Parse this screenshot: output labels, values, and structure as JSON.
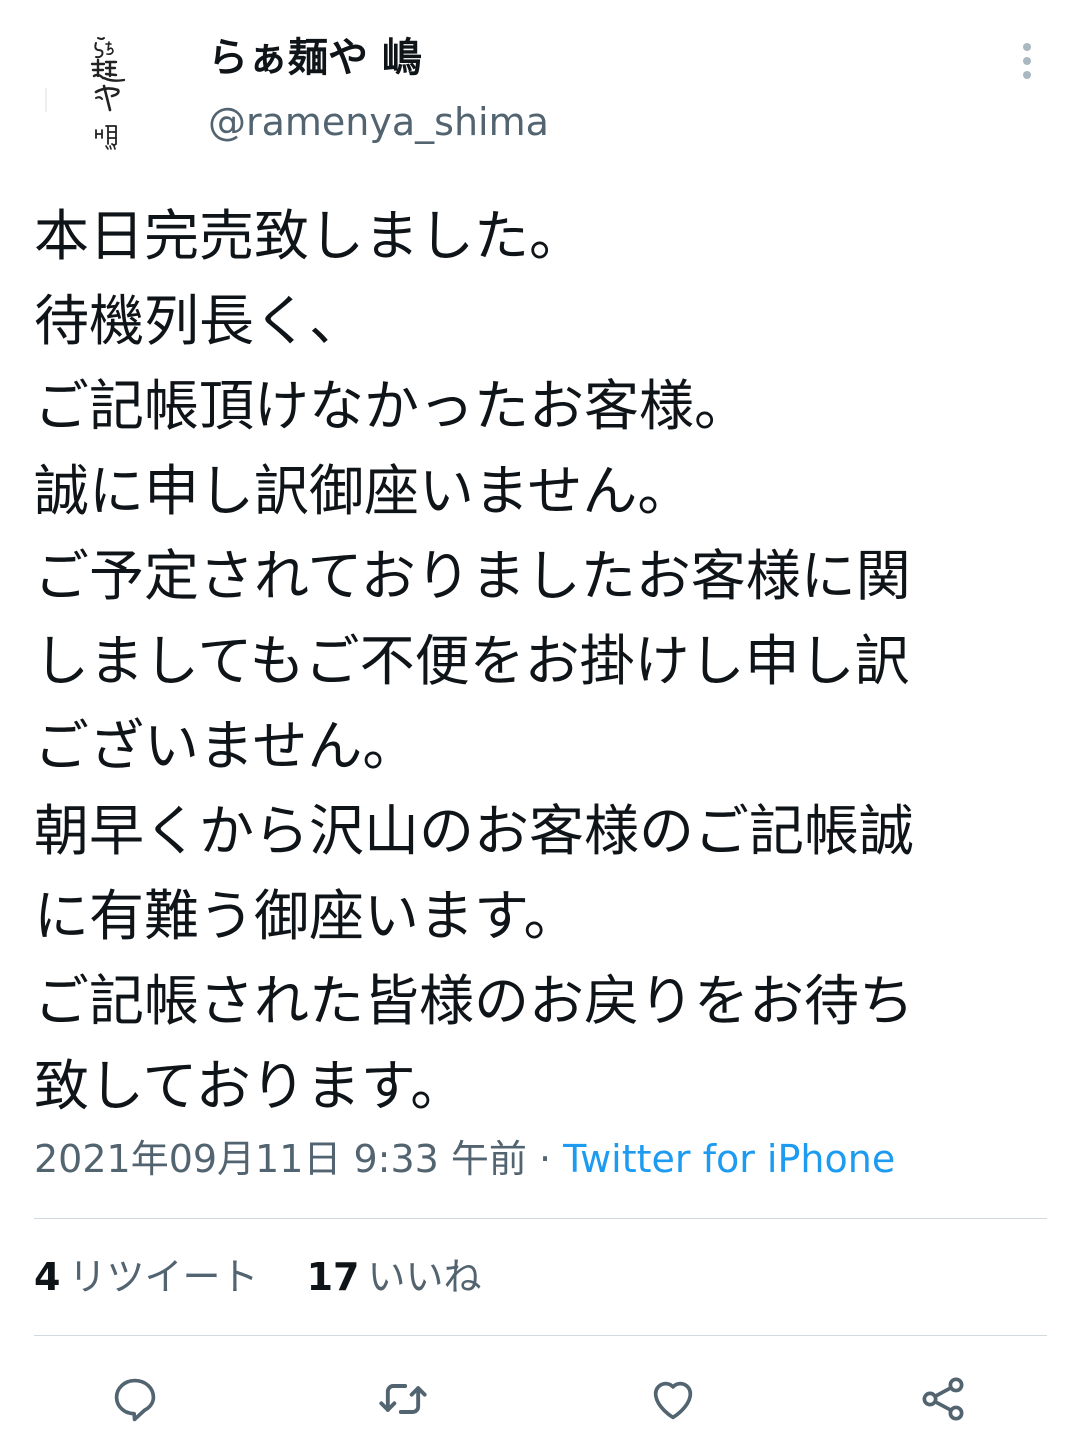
{
  "account": {
    "display_name": "らぁ麺や 嶋",
    "handle": "@ramenya_shima",
    "avatar_text": "らぁ麺や 嶋"
  },
  "tweet": {
    "lines": [
      "本日完売致しました。",
      "待機列長く、",
      "ご記帳頂けなかったお客様。",
      "誠に申し訳御座いません。",
      "ご予定されておりましたお客様に関",
      "しましてもご不便をお掛けし申し訳",
      "ございません。",
      "朝早くから沢山のお客様のご記帳誠",
      "に有難う御座います。",
      "ご記帳された皆様のお戻りをお待ち",
      "致しております。"
    ]
  },
  "meta": {
    "timestamp": "2021年09月11日 9:33 午前",
    "separator": " · ",
    "source": "Twitter for iPhone"
  },
  "stats": {
    "retweets_count": "4",
    "retweets_label": "リツイート",
    "likes_count": "17",
    "likes_label": "いいね"
  },
  "icons": {
    "more": "more-vertical-icon",
    "reply": "reply-icon",
    "retweet": "retweet-icon",
    "like": "heart-icon",
    "share": "share-icon"
  },
  "colors": {
    "text": "#0f1419",
    "secondary": "#536471",
    "link": "#1d9bf0",
    "divider": "#cfd9de"
  }
}
